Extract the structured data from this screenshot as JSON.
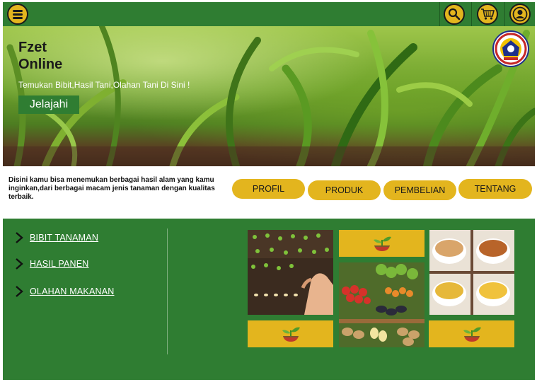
{
  "colors": {
    "primary_green": "#2f7d32",
    "accent_yellow": "#e3b51e",
    "text_dark": "#1a1a1a"
  },
  "topbar": {
    "menu_icon": "hamburger-menu-icon",
    "search_icon": "search-icon",
    "cart_icon": "shopping-cart-icon",
    "account_icon": "user-account-icon"
  },
  "hero": {
    "title_line1": "Fzet",
    "title_line2": "Online",
    "subtitle": "Temukan Bibit,Hasil Tani,Olahan Tani Di Sini !",
    "cta_label": "Jelajahi",
    "logo_icon": "institution-logo-icon"
  },
  "info": {
    "description": "Disini kamu bisa menemukan berbagai hasil alam yang kamu inginkan,dari berbagai macam jenis tanaman dengan kualitas terbaik.",
    "nav": [
      "PROFIL",
      "PRODUK",
      "PEMBELIAN",
      "TENTANG"
    ]
  },
  "categories": [
    {
      "label": "BIBIT TANAMAN",
      "icon": "chevron-right-icon"
    },
    {
      "label": "HASIL PANEN",
      "icon": "chevron-right-icon"
    },
    {
      "label": "OLAHAN MAKANAN",
      "icon": "chevron-right-icon"
    }
  ],
  "gallery": {
    "images": [
      "seedlings-planting-photo",
      "vegetable-market-photo",
      "processed-snacks-photo"
    ],
    "placeholder_icon": "sprout-bowl-icon"
  }
}
